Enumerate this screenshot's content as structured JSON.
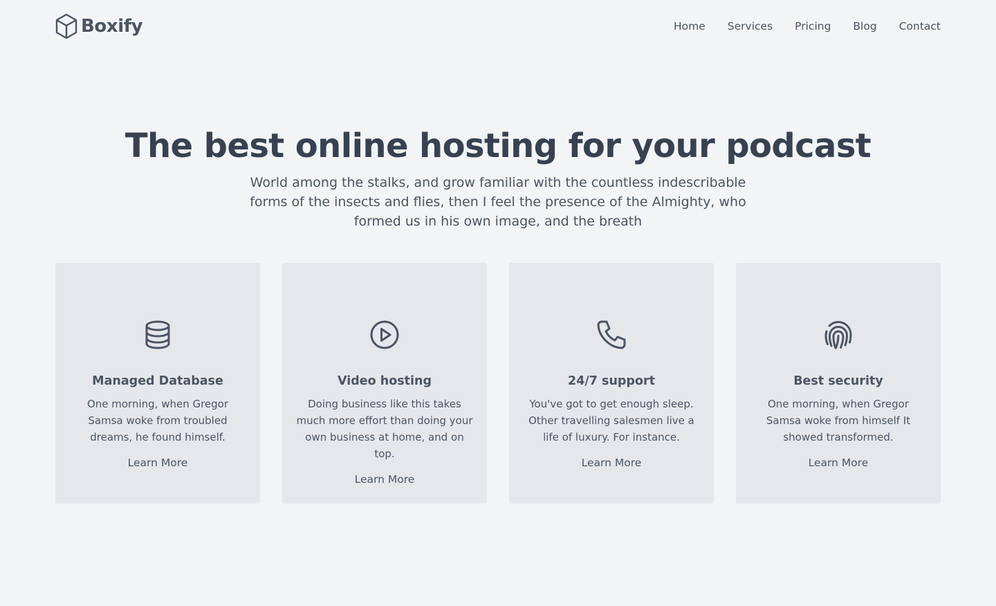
{
  "brand": {
    "name": "Boxify",
    "icon": "cube-icon"
  },
  "nav": {
    "items": [
      "Home",
      "Services",
      "Pricing",
      "Blog",
      "Contact"
    ]
  },
  "hero": {
    "title": "The best online hosting for your podcast",
    "subtitle": "World among the stalks, and grow familiar with the countless indescribable forms of the insects and flies, then I feel the presence of the Almighty, who formed us in his own image, and the breath"
  },
  "cards": [
    {
      "icon": "database-icon",
      "title": "Managed Database",
      "description": "One morning, when Gregor Samsa woke from troubled dreams, he found himself.",
      "link": "Learn More"
    },
    {
      "icon": "play-circle-icon",
      "title": "Video hosting",
      "description": "Doing business like this takes much more effort than doing your own business at home, and on top.",
      "link": "Learn More"
    },
    {
      "icon": "phone-icon",
      "title": "24/7 support",
      "description": "You've got to get enough sleep. Other travelling salesmen live a life of luxury. For instance.",
      "link": "Learn More"
    },
    {
      "icon": "fingerprint-icon",
      "title": "Best security",
      "description": "One morning, when Gregor Samsa woke from himself It showed transformed.",
      "link": "Learn More"
    }
  ],
  "colors": {
    "background": "#f3f4f6",
    "card": "#e5e7eb",
    "text": "#374151",
    "muted": "#4b5563"
  }
}
